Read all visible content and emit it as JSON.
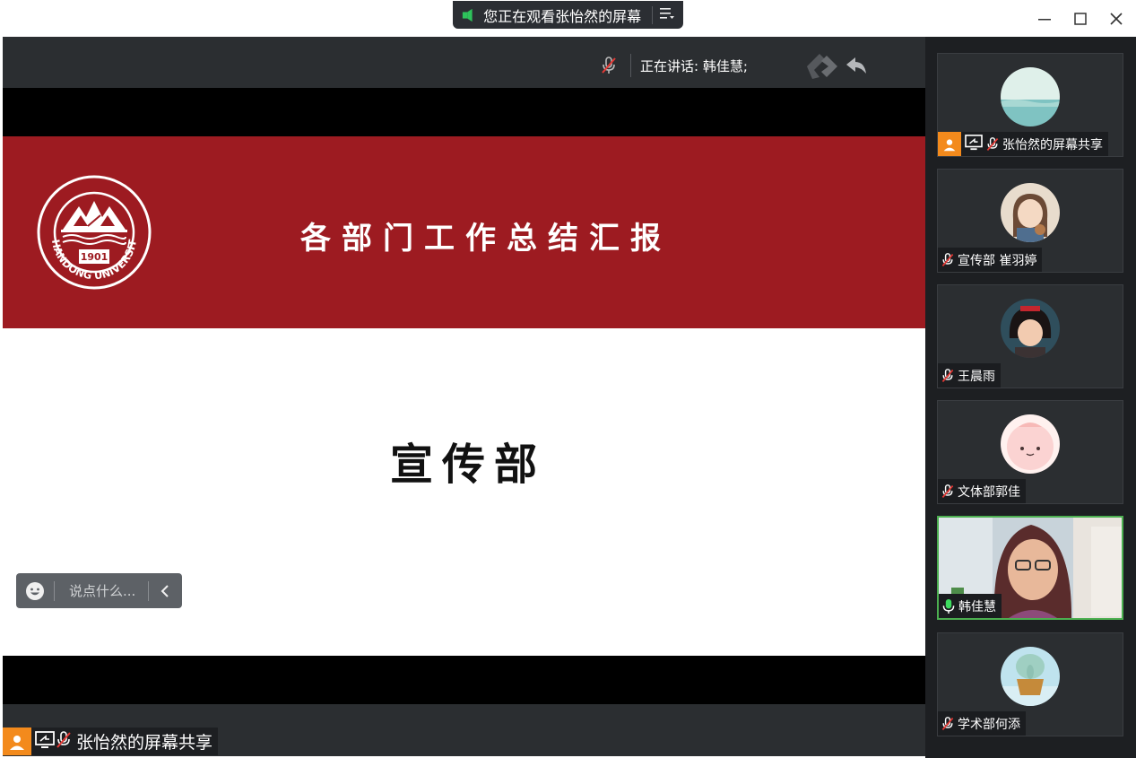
{
  "window": {
    "share_banner": "您正在观看张怡然的屏幕",
    "minimize_glyph": "—",
    "maximize_glyph": "☐",
    "close_glyph": "✕"
  },
  "speaking": {
    "label": "正在讲话: 韩佳慧;"
  },
  "slide": {
    "title": "各部门工作总结汇报",
    "department": "宣传部",
    "logo_text_bottom": "SHANDONG UNIVERSITY",
    "logo_year": "1901"
  },
  "chat": {
    "placeholder": "说点什么..."
  },
  "presenter": {
    "name": "张怡然的屏幕共享"
  },
  "participants": [
    {
      "name": "张怡然的屏幕共享",
      "muted": true,
      "avatar": "sea",
      "sharing": true
    },
    {
      "name": "宣传部 崔羽婷",
      "muted": true,
      "avatar": "girl-cartoon"
    },
    {
      "name": "王晨雨",
      "muted": true,
      "avatar": "anime-girl"
    },
    {
      "name": "文体部郭佳",
      "muted": true,
      "avatar": "pink-blob"
    },
    {
      "name": "韩佳慧",
      "muted": false,
      "avatar": "camera",
      "active": true
    },
    {
      "name": "学术部何添",
      "muted": true,
      "avatar": "squidward"
    }
  ],
  "colors": {
    "slide_red": "#9d1b21",
    "dark_bg": "#2b2e31",
    "active_green": "#4caf50",
    "orange": "#f38a1c"
  }
}
